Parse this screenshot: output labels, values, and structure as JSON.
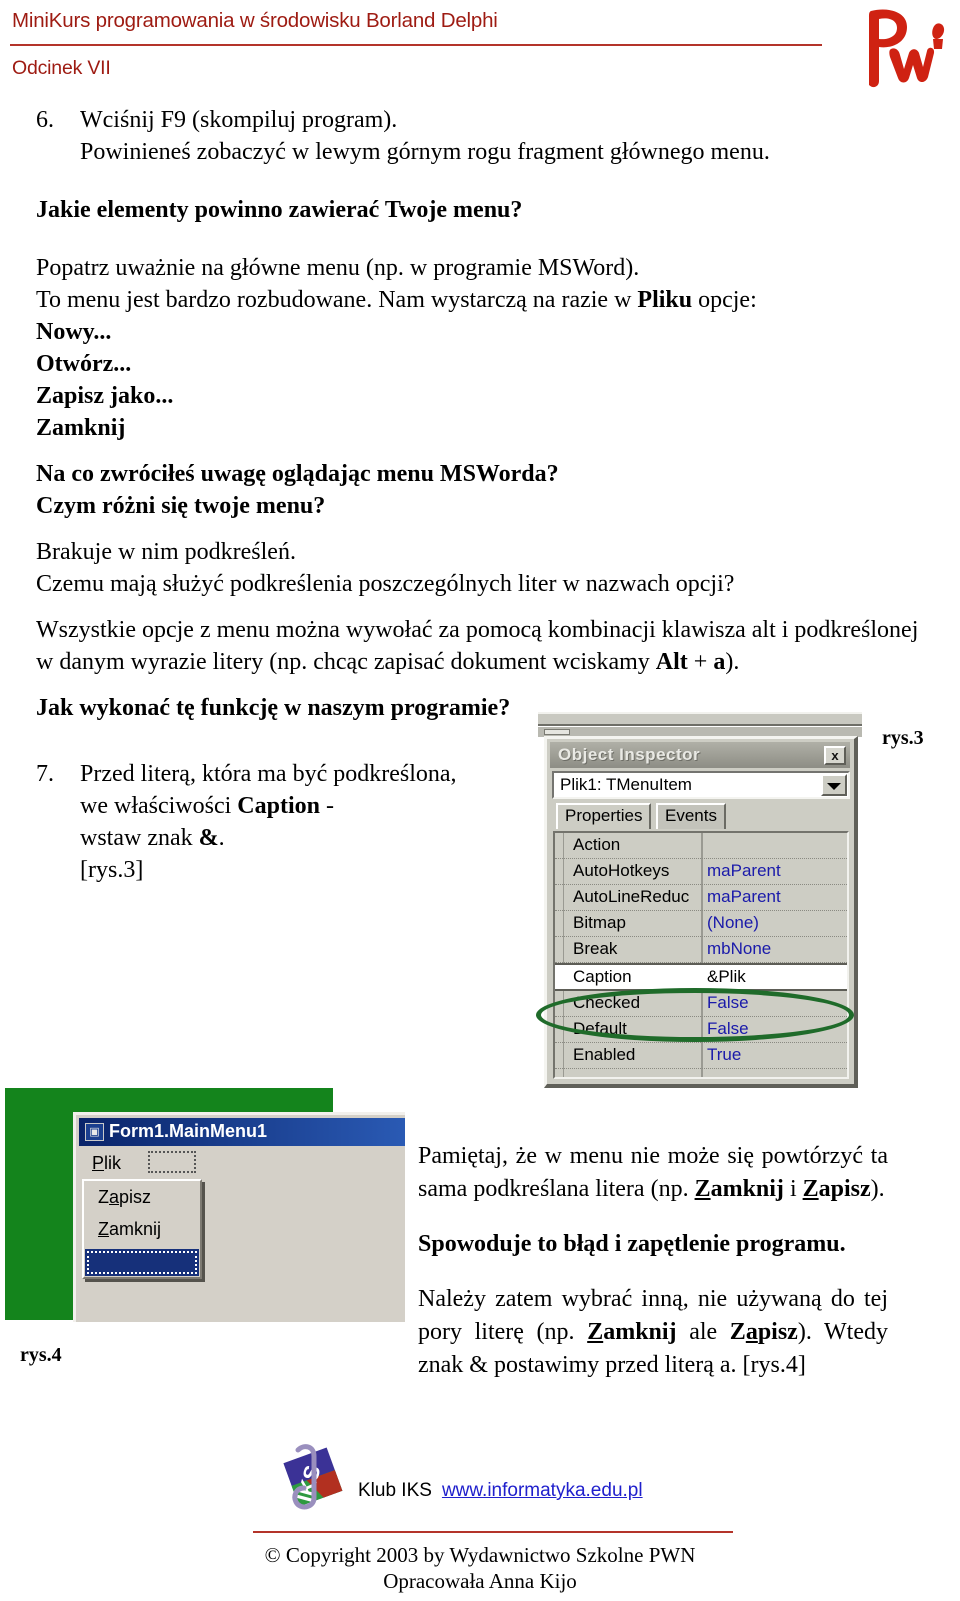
{
  "header": {
    "title": "MiniKurs programowania w środowisku Borland Delphi",
    "subtitle": "Odcinek VII",
    "logo_icon": "pwn-logo-icon"
  },
  "lesson": {
    "item6": {
      "number": "6.",
      "line1": "Wciśnij F9 (skompiluj program).",
      "line2": "Powinieneś zobaczyć w lewym górnym rogu fragment głównego menu."
    },
    "q1": "Jakie elementy powinno zawierać Twoje menu?",
    "p1_line1": "Popatrz uważnie na główne menu (np. w programie MSWord).",
    "p1_line2_a": "To menu jest bardzo rozbudowane. Nam wystarczą na razie w ",
    "p1_line2_b": "Pliku",
    "p1_line2_c": " opcje:",
    "menu_options": [
      "Nowy...",
      "Otwórz...",
      "Zapisz jako...",
      "Zamknij"
    ],
    "q2_line1": "Na co zwróciłeś uwagę oglądając menu MSWorda?",
    "q2_line2": "Czym różni się twoje menu?",
    "p2_line1": "Brakuje w nim podkreśleń.",
    "p2_line2": "Czemu mają służyć podkreślenia poszczególnych liter w nazwach opcji?",
    "p3_line1": "Wszystkie opcje z menu można wywołać za pomocą kombinacji klawisza alt i podkreślonej",
    "p3_line2_a": "w danym wyrazie litery (np. chcąc zapisać dokument wciskamy ",
    "p3_line2_b": "Alt",
    "p3_line2_c": " + ",
    "p3_line2_d": "a",
    "p3_line2_e": ").",
    "q3": "Jak wykonać tę funkcję w naszym programie?",
    "item7": {
      "number": "7.",
      "line1": "Przed literą, która ma być podkreślona,",
      "line2_a": "we właściwości ",
      "line2_b": "Caption",
      "line2_c": " -",
      "line3_a": "wstaw znak ",
      "line3_b": "&",
      "line3_c": ".",
      "line4": "[rys.3]"
    }
  },
  "object_inspector": {
    "title": "Object Inspector",
    "close_label": "x",
    "close_icon": "close-icon",
    "selected_object": "Plik1: TMenuItem",
    "dropdown_icon": "chevron-down-icon",
    "tabs": [
      "Properties",
      "Events"
    ],
    "rows": [
      {
        "key": "Action",
        "value": ""
      },
      {
        "key": "AutoHotkeys",
        "value": "maParent"
      },
      {
        "key": "AutoLineReduc",
        "value": "maParent"
      },
      {
        "key": "Bitmap",
        "value": "(None)"
      },
      {
        "key": "Break",
        "value": "mbNone"
      },
      {
        "key": "Caption",
        "value": "&Plik",
        "highlighted": true
      },
      {
        "key": "Checked",
        "value": "False"
      },
      {
        "key": "Default",
        "value": "False"
      },
      {
        "key": "Enabled",
        "value": "True"
      }
    ],
    "annotation_color": "#1f6b2a",
    "figure_label": "rys.3"
  },
  "main_menu_designer": {
    "window_title": "Form1.MainMenu1",
    "icon": "menu-designer-icon",
    "menubar_item_pre": "P",
    "menubar_item_post": "lik",
    "empty_slot": "",
    "dropdown_items": [
      {
        "pre": "Z",
        "underline": "a",
        "post": "pisz"
      },
      {
        "pre": "",
        "underline": "Z",
        "post": "amknij"
      }
    ],
    "selected_empty_item": "",
    "background_color": "#14841c",
    "figure_label": "rys.4"
  },
  "notes": {
    "p1_a": "Pamiętaj, że w menu nie może się powtórzyć ta sama podkreślana litera (np. ",
    "p1_bold1_u": "Z",
    "p1_bold1_rest": "amknij",
    "p1_mid": " i ",
    "p1_bold2_u": "Z",
    "p1_bold2_rest": "apisz",
    "p1_end": ").",
    "p2": "Spowoduje to błąd i zapętlenie programu.",
    "p3_a": "Należy zatem wybrać inną, nie używaną do tej pory literę (np. ",
    "p3_bold1_u": "Z",
    "p3_bold1_rest": "amknij",
    "p3_mid": " ale ",
    "p3_bold2_pre": "Z",
    "p3_bold2_u": "a",
    "p3_bold2_rest": "pisz",
    "p3_end": "). Wtedy znak & postawimy przed literą a. [rys.4]"
  },
  "footer": {
    "logo_icon": "iks-logo-icon",
    "club": "Klub IKS",
    "link": "www.informatyka.edu.pl",
    "copyright": "© Copyright 2003 by Wydawnictwo Szkolne PWN",
    "author": "Opracowała Anna Kijo"
  }
}
